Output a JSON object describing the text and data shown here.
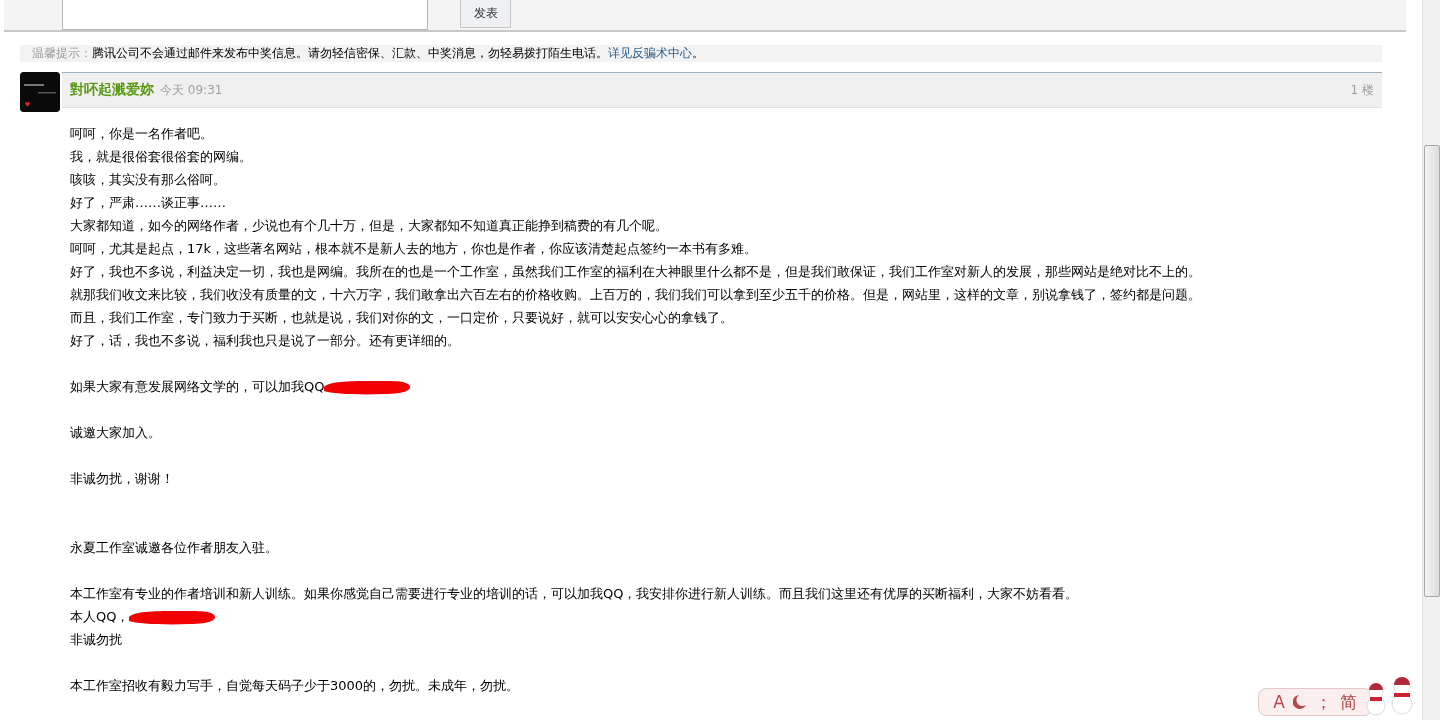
{
  "reply_box": {
    "submit": "发表"
  },
  "notice": {
    "label": "温馨提示：",
    "text": "腾讯公司不会通过邮件来发布中奖信息。请勿轻信密保、汇款、中奖消息，勿轻易拨打陌生电话。",
    "link": "详见反骗术中心",
    "end": "。"
  },
  "post": {
    "author": "對吥起溅爱妳",
    "time": "今天 09:31",
    "floor": "1 楼",
    "blocks": [
      {
        "extra_space": false,
        "lines": [
          {
            "text": "呵呵，你是一名作者吧。",
            "redacted": false
          },
          {
            "text": "我，就是很俗套很俗套的网编。",
            "redacted": false
          },
          {
            "text": "咳咳，其实没有那么俗呵。",
            "redacted": false
          },
          {
            "text": "好了，严肃……谈正事……",
            "redacted": false
          },
          {
            "text": "大家都知道，如今的网络作者，少说也有个几十万，但是，大家都知不知道真正能挣到稿费的有几个呢。",
            "redacted": false
          },
          {
            "text": "呵呵，尤其是起点，17k，这些著名网站，根本就不是新人去的地方，你也是作者，你应该清楚起点签约一本书有多难。",
            "redacted": false
          },
          {
            "text": "好了，我也不多说，利益决定一切，我也是网编。我所在的也是一个工作室，虽然我们工作室的福利在大神眼里什么都不是，但是我们敢保证，我们工作室对新人的发展，那些网站是绝对比不上的。",
            "redacted": false
          },
          {
            "text": "就那我们收文来比较，我们收没有质量的文，十六万字，我们敢拿出六百左右的价格收购。上百万的，我们我们可以拿到至少五千的价格。但是，网站里，这样的文章，别说拿钱了，签约都是问题。",
            "redacted": false
          },
          {
            "text": "而且，我们工作室，专门致力于买断，也就是说，我们对你的文，一口定价，只要说好，就可以安安心心的拿钱了。",
            "redacted": false
          },
          {
            "text": "好了，话，我也不多说，福利我也只是说了一部分。还有更详细的。",
            "redacted": false
          }
        ]
      },
      {
        "extra_space": false,
        "lines": [
          {
            "text": "如果大家有意发展网络文学的，可以加我QQ",
            "redacted": true
          }
        ]
      },
      {
        "extra_space": false,
        "lines": [
          {
            "text": "诚邀大家加入。",
            "redacted": false
          }
        ]
      },
      {
        "extra_space": true,
        "lines": [
          {
            "text": "非诚勿扰，谢谢！",
            "redacted": false
          }
        ]
      },
      {
        "extra_space": false,
        "lines": [
          {
            "text": "永夏工作室诚邀各位作者朋友入驻。",
            "redacted": false
          }
        ]
      },
      {
        "extra_space": false,
        "lines": [
          {
            "text": "本工作室有专业的作者培训和新人训练。如果你感觉自己需要进行专业的培训的话，可以加我QQ，我安排你进行新人训练。而且我们这里还有优厚的买断福利，大家不妨看看。",
            "redacted": false
          },
          {
            "text": "本人QQ，",
            "redacted": true
          },
          {
            "text": "非诚勿扰",
            "redacted": false
          }
        ]
      },
      {
        "extra_space": false,
        "lines": [
          {
            "text": "本工作室招收有毅力写手，自觉每天码子少于3000的，勿扰。未成年，勿扰。",
            "redacted": false
          }
        ]
      }
    ]
  },
  "float_toolbar": {
    "items": [
      {
        "kind": "text",
        "label": "A"
      },
      {
        "kind": "moon"
      },
      {
        "kind": "text",
        "label": "；"
      },
      {
        "kind": "text",
        "label": "简"
      }
    ]
  }
}
